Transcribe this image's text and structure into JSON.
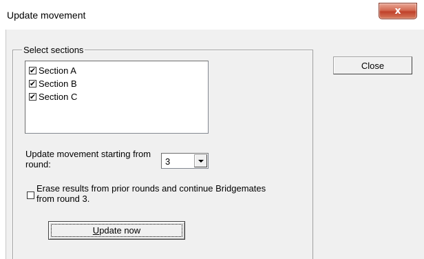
{
  "window": {
    "title": "Update movement",
    "close_glyph": "x"
  },
  "sections_group": {
    "label": "Select sections",
    "items": [
      {
        "label": "Section A",
        "checked": true
      },
      {
        "label": "Section B",
        "checked": true
      },
      {
        "label": "Section C",
        "checked": true
      }
    ]
  },
  "start_round": {
    "label": "Update movement starting from round:",
    "value": "3"
  },
  "erase": {
    "checked": false,
    "label_line1": "Erase results from prior rounds and continue Bridgemates",
    "label_line2": "from round 3."
  },
  "buttons": {
    "update_mnemonic": "U",
    "update_rest": "pdate now",
    "close": "Close"
  },
  "glyphs": {
    "check": "✔"
  }
}
